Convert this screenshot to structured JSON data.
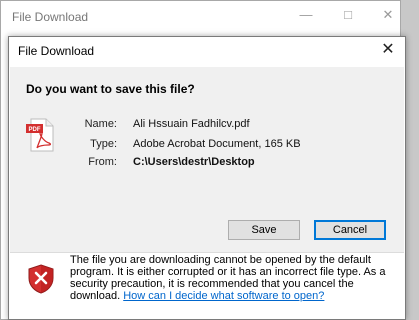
{
  "background_window": {
    "title": "File Download"
  },
  "dialog": {
    "title": "File Download",
    "question": "Do you want to save this file?",
    "file": {
      "name_label": "Name:",
      "name": "Ali Hssuain Fadhilcv.pdf",
      "type_label": "Type:",
      "type": "Adobe Acrobat Document, 165 KB",
      "from_label": "From:",
      "from": "C:\\Users\\destr\\Desktop"
    },
    "buttons": {
      "save": "Save",
      "cancel": "Cancel"
    },
    "warning": {
      "text": "The file you are downloading cannot be opened by the default program. It is either corrupted or it has an incorrect file type. As a security precaution, it is recommended that you cancel the download. ",
      "link": "How can I decide what software to open?"
    },
    "icons": {
      "file": "pdf-file-icon",
      "warning": "security-shield-icon",
      "close": "close-icon"
    }
  },
  "colors": {
    "accent": "#0078d7",
    "link": "#0066cc",
    "pane": "#f0f0f0",
    "shield": "#d32f2f"
  }
}
